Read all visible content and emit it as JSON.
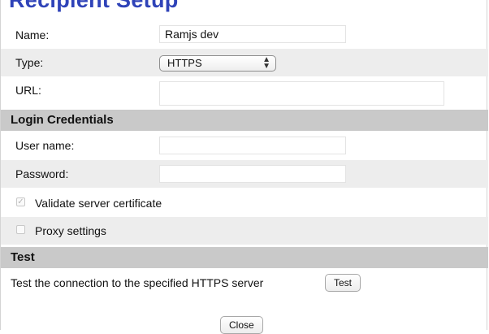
{
  "dialog": {
    "title": "Recipient Setup",
    "name": {
      "label": "Name:",
      "value": "Ramjs dev"
    },
    "type": {
      "label": "Type:",
      "value": "HTTPS"
    },
    "url": {
      "label": "URL:",
      "value": ""
    },
    "login_section": "Login Credentials",
    "username": {
      "label": "User name:",
      "value": ""
    },
    "password": {
      "label": "Password:",
      "value": ""
    },
    "validate_cert": {
      "label": "Validate server certificate",
      "checked": true,
      "disabled": true
    },
    "proxy": {
      "label": "Proxy settings",
      "checked": false,
      "disabled": true
    },
    "test_section": "Test",
    "test_text": "Test the connection to the specified HTTPS server",
    "test_button": "Test",
    "close_button": "Close"
  }
}
